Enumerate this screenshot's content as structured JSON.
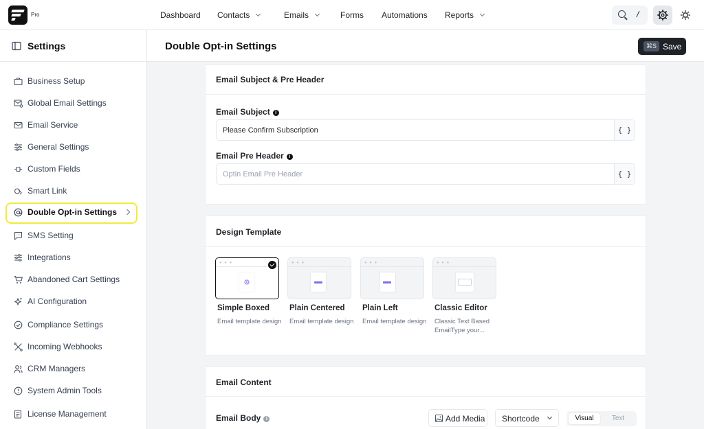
{
  "brand": {
    "logo_badge": "Pro"
  },
  "topnav": {
    "items": [
      {
        "label": "Dashboard",
        "dropdown": false
      },
      {
        "label": "Contacts",
        "dropdown": true
      },
      {
        "label": "Emails",
        "dropdown": true
      },
      {
        "label": "Forms",
        "dropdown": false
      },
      {
        "label": "Automations",
        "dropdown": false
      },
      {
        "label": "Reports",
        "dropdown": true
      }
    ],
    "search_shortcut": "/"
  },
  "sidebar": {
    "title": "Settings",
    "items": [
      {
        "label": "Business Setup",
        "icon": "briefcase-icon"
      },
      {
        "label": "Global Email Settings",
        "icon": "mail-settings-icon"
      },
      {
        "label": "Email Service",
        "icon": "envelope-icon"
      },
      {
        "label": "General Settings",
        "icon": "sliders-icon"
      },
      {
        "label": "Custom Fields",
        "icon": "custom-fields-icon"
      },
      {
        "label": "Smart Link",
        "icon": "link-icon"
      },
      {
        "label": "Double Opt-in Settings",
        "icon": "at-icon",
        "active": true
      },
      {
        "label": "SMS Setting",
        "icon": "chat-icon"
      },
      {
        "label": "Integrations",
        "icon": "integrations-icon"
      },
      {
        "label": "Abandoned Cart Settings",
        "icon": "cart-icon"
      },
      {
        "label": "AI Configuration",
        "icon": "sparkle-icon"
      },
      {
        "label": "Compliance Settings",
        "icon": "check-circle-icon"
      },
      {
        "label": "Incoming Webhooks",
        "icon": "webhook-icon"
      },
      {
        "label": "CRM Managers",
        "icon": "users-icon"
      },
      {
        "label": "System Admin Tools",
        "icon": "info-circle-icon"
      },
      {
        "label": "License Management",
        "icon": "license-icon"
      }
    ]
  },
  "header": {
    "title": "Double Opt-in Settings",
    "save_shortcut": "⌘S",
    "save_label": "Save"
  },
  "subject_card": {
    "title": "Email Subject & Pre Header",
    "subject_label": "Email Subject",
    "subject_value": "Please Confirm Subscription",
    "preheader_label": "Email Pre Header",
    "preheader_placeholder": "Optin Email Pre Header",
    "shortcode_glyph": "{ }"
  },
  "design_card": {
    "title": "Design Template",
    "templates": [
      {
        "name": "Simple Boxed",
        "desc": "Email template design",
        "selected": true
      },
      {
        "name": "Plain Centered",
        "desc": "Email template design",
        "selected": false
      },
      {
        "name": "Plain Left",
        "desc": "Email template design",
        "selected": false
      },
      {
        "name": "Classic Editor",
        "desc": "Classic Text Based EmailType your...",
        "selected": false
      }
    ]
  },
  "content_card": {
    "title": "Email Content",
    "body_label": "Email Body",
    "add_media": "Add Media",
    "shortcode": "Shortcode",
    "tab_visual": "Visual",
    "tab_text": "Text"
  }
}
